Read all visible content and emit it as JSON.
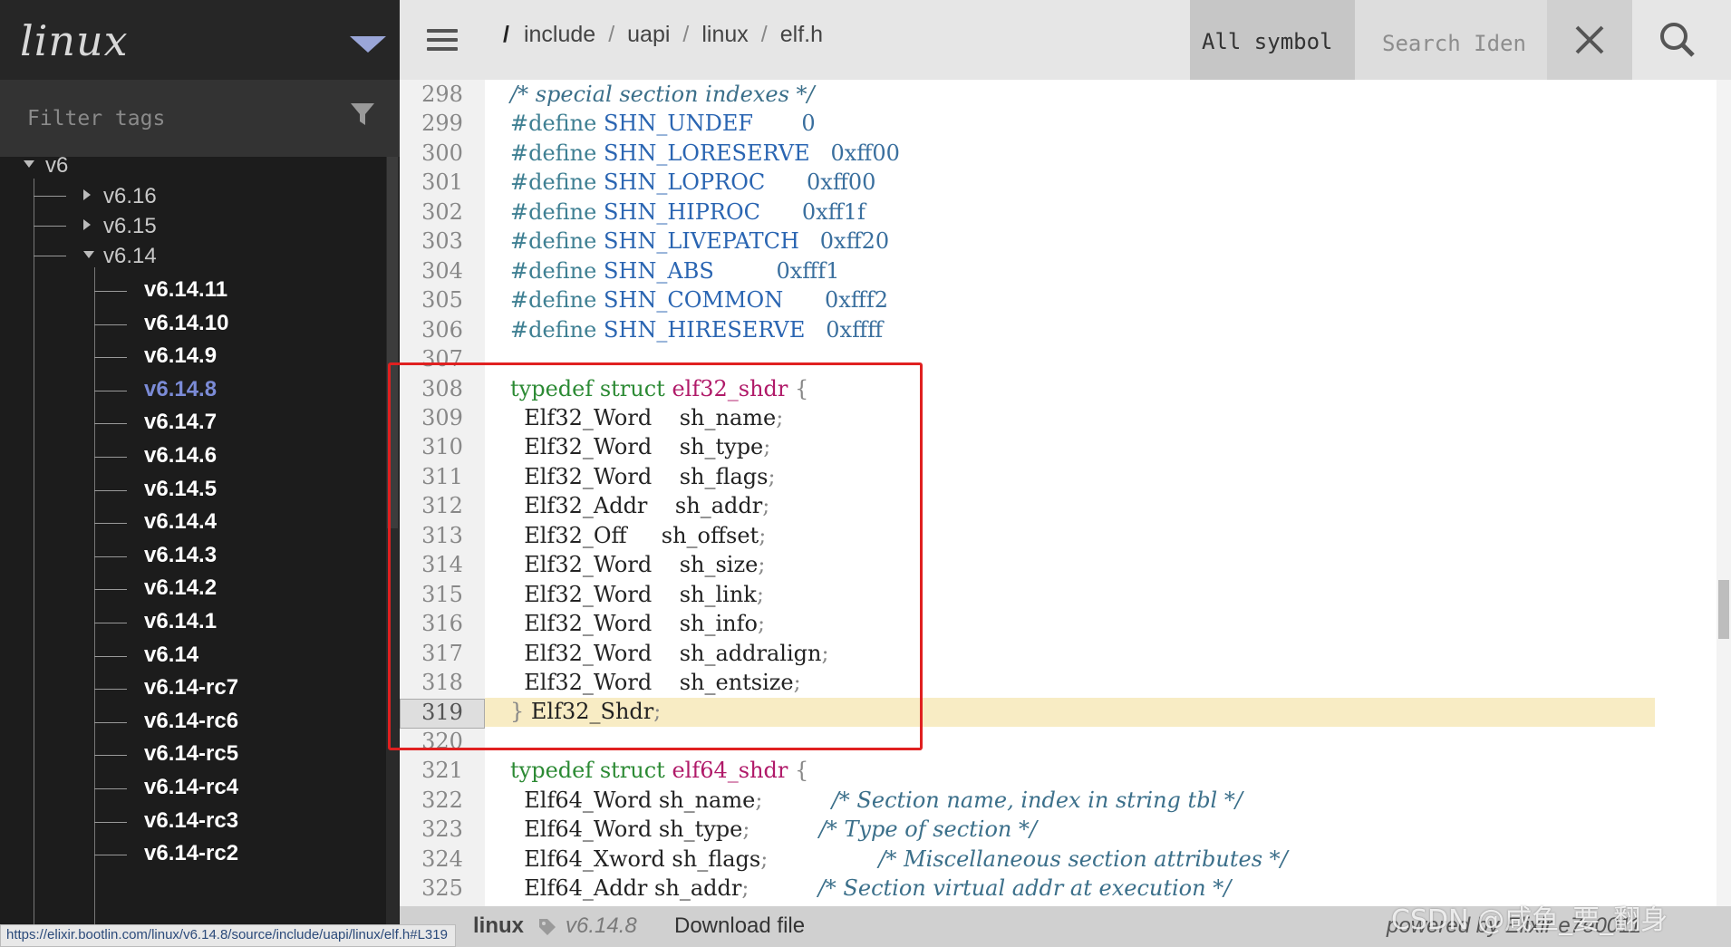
{
  "sidebar": {
    "logo": "linux",
    "filter_placeholder": "Filter tags",
    "groups": [
      {
        "label": "v6",
        "expanded": true
      },
      {
        "label": "v6.16",
        "expanded": false
      },
      {
        "label": "v6.15",
        "expanded": false
      },
      {
        "label": "v6.14",
        "expanded": true
      }
    ],
    "tags": [
      "v6.14.11",
      "v6.14.10",
      "v6.14.9",
      "v6.14.8",
      "v6.14.7",
      "v6.14.6",
      "v6.14.5",
      "v6.14.4",
      "v6.14.3",
      "v6.14.2",
      "v6.14.1",
      "v6.14",
      "v6.14-rc7",
      "v6.14-rc6",
      "v6.14-rc5",
      "v6.14-rc4",
      "v6.14-rc3",
      "v6.14-rc2"
    ],
    "active_tag": "v6.14.8"
  },
  "topbar": {
    "breadcrumb_root": "/",
    "breadcrumb": [
      "include",
      "uapi",
      "linux",
      "elf.h"
    ],
    "breadcrumb_sep": "/",
    "symbol_select": "All symbol",
    "search_placeholder": "Search Iden"
  },
  "code": {
    "highlighted_line": "319",
    "lines": [
      {
        "n": "298",
        "parts": [
          [
            "c-cm",
            "/* special section indexes */"
          ]
        ]
      },
      {
        "n": "299",
        "parts": [
          [
            "c-pp",
            "#define "
          ],
          [
            "c-mac",
            "SHN_UNDEF"
          ],
          [
            "",
            "       "
          ],
          [
            "c-num",
            "0"
          ]
        ]
      },
      {
        "n": "300",
        "parts": [
          [
            "c-pp",
            "#define "
          ],
          [
            "c-mac",
            "SHN_LORESERVE"
          ],
          [
            "",
            "   "
          ],
          [
            "c-num",
            "0xff00"
          ]
        ]
      },
      {
        "n": "301",
        "parts": [
          [
            "c-pp",
            "#define "
          ],
          [
            "c-mac",
            "SHN_LOPROC"
          ],
          [
            "",
            "      "
          ],
          [
            "c-num",
            "0xff00"
          ]
        ]
      },
      {
        "n": "302",
        "parts": [
          [
            "c-pp",
            "#define "
          ],
          [
            "c-mac",
            "SHN_HIPROC"
          ],
          [
            "",
            "      "
          ],
          [
            "c-num",
            "0xff1f"
          ]
        ]
      },
      {
        "n": "303",
        "parts": [
          [
            "c-pp",
            "#define "
          ],
          [
            "c-mac",
            "SHN_LIVEPATCH"
          ],
          [
            "",
            "   "
          ],
          [
            "c-num",
            "0xff20"
          ]
        ]
      },
      {
        "n": "304",
        "parts": [
          [
            "c-pp",
            "#define "
          ],
          [
            "c-mac",
            "SHN_ABS"
          ],
          [
            "",
            "         "
          ],
          [
            "c-num",
            "0xfff1"
          ]
        ]
      },
      {
        "n": "305",
        "parts": [
          [
            "c-pp",
            "#define "
          ],
          [
            "c-mac",
            "SHN_COMMON"
          ],
          [
            "",
            "      "
          ],
          [
            "c-num",
            "0xfff2"
          ]
        ]
      },
      {
        "n": "306",
        "parts": [
          [
            "c-pp",
            "#define "
          ],
          [
            "c-mac",
            "SHN_HIRESERVE"
          ],
          [
            "",
            "   "
          ],
          [
            "c-num",
            "0xffff"
          ]
        ]
      },
      {
        "n": "307",
        "parts": []
      },
      {
        "n": "308",
        "parts": [
          [
            "c-kw",
            "typedef struct "
          ],
          [
            "c-sn",
            "elf32_shdr"
          ],
          [
            "c-p",
            " {"
          ]
        ]
      },
      {
        "n": "309",
        "parts": [
          [
            "c-ty",
            "  Elf32_Word    "
          ],
          [
            "c-id",
            "sh_name"
          ],
          [
            "c-p",
            ";"
          ]
        ]
      },
      {
        "n": "310",
        "parts": [
          [
            "c-ty",
            "  Elf32_Word    "
          ],
          [
            "c-id",
            "sh_type"
          ],
          [
            "c-p",
            ";"
          ]
        ]
      },
      {
        "n": "311",
        "parts": [
          [
            "c-ty",
            "  Elf32_Word    "
          ],
          [
            "c-id",
            "sh_flags"
          ],
          [
            "c-p",
            ";"
          ]
        ]
      },
      {
        "n": "312",
        "parts": [
          [
            "c-ty",
            "  Elf32_Addr    "
          ],
          [
            "c-id",
            "sh_addr"
          ],
          [
            "c-p",
            ";"
          ]
        ]
      },
      {
        "n": "313",
        "parts": [
          [
            "c-ty",
            "  Elf32_Off     "
          ],
          [
            "c-id",
            "sh_offset"
          ],
          [
            "c-p",
            ";"
          ]
        ]
      },
      {
        "n": "314",
        "parts": [
          [
            "c-ty",
            "  Elf32_Word    "
          ],
          [
            "c-id",
            "sh_size"
          ],
          [
            "c-p",
            ";"
          ]
        ]
      },
      {
        "n": "315",
        "parts": [
          [
            "c-ty",
            "  Elf32_Word    "
          ],
          [
            "c-id",
            "sh_link"
          ],
          [
            "c-p",
            ";"
          ]
        ]
      },
      {
        "n": "316",
        "parts": [
          [
            "c-ty",
            "  Elf32_Word    "
          ],
          [
            "c-id",
            "sh_info"
          ],
          [
            "c-p",
            ";"
          ]
        ]
      },
      {
        "n": "317",
        "parts": [
          [
            "c-ty",
            "  Elf32_Word    "
          ],
          [
            "c-id",
            "sh_addralign"
          ],
          [
            "c-p",
            ";"
          ]
        ]
      },
      {
        "n": "318",
        "parts": [
          [
            "c-ty",
            "  Elf32_Word    "
          ],
          [
            "c-id",
            "sh_entsize"
          ],
          [
            "c-p",
            ";"
          ]
        ]
      },
      {
        "n": "319",
        "parts": [
          [
            "c-p",
            "} "
          ],
          [
            "c-ty",
            "Elf32_Shdr"
          ],
          [
            "c-p",
            ";"
          ]
        ]
      },
      {
        "n": "320",
        "parts": []
      },
      {
        "n": "321",
        "parts": [
          [
            "c-kw",
            "typedef struct "
          ],
          [
            "c-sn",
            "elf64_shdr"
          ],
          [
            "c-p",
            " {"
          ]
        ]
      },
      {
        "n": "322",
        "parts": [
          [
            "c-ty",
            "  Elf64_Word "
          ],
          [
            "c-id",
            "sh_name"
          ],
          [
            "c-p",
            ";"
          ],
          [
            "",
            "          "
          ],
          [
            "c-cm",
            "/* Section name, index in string tbl */"
          ]
        ]
      },
      {
        "n": "323",
        "parts": [
          [
            "c-ty",
            "  Elf64_Word "
          ],
          [
            "c-id",
            "sh_type"
          ],
          [
            "c-p",
            ";"
          ],
          [
            "",
            "          "
          ],
          [
            "c-cm",
            "/* Type of section */"
          ]
        ]
      },
      {
        "n": "324",
        "parts": [
          [
            "c-ty",
            "  Elf64_Xword "
          ],
          [
            "c-id",
            "sh_flags"
          ],
          [
            "c-p",
            ";"
          ],
          [
            "",
            "                "
          ],
          [
            "c-cm",
            "/* Miscellaneous section attributes */"
          ]
        ]
      },
      {
        "n": "325",
        "parts": [
          [
            "c-ty",
            "  Elf64_Addr "
          ],
          [
            "c-id",
            "sh_addr"
          ],
          [
            "c-p",
            ";"
          ],
          [
            "",
            "          "
          ],
          [
            "c-cm",
            "/* Section virtual addr at execution */"
          ]
        ]
      }
    ]
  },
  "footer": {
    "project": "linux",
    "version": "v6.14.8",
    "download": "Download file",
    "powered": "powered by Elixir e7e0011"
  },
  "statusbar_url": "https://elixir.bootlin.com/linux/v6.14.8/source/include/uapi/linux/elf.h#L319",
  "watermark": "CSDN @咸鱼_要_翻身",
  "colors": {
    "sidebar_bg": "#1c1c1c",
    "active_tag": "#7b8bd6",
    "highlight_line": "#f8ecc4",
    "annotation_box": "#e02020",
    "keyword": "#2c8a34",
    "struct_name": "#b01a69",
    "macro": "#2a65b2"
  },
  "icons": [
    "menu-icon",
    "filter-icon",
    "close-icon",
    "search-icon",
    "tag-icon",
    "expand-triangle-icon"
  ]
}
